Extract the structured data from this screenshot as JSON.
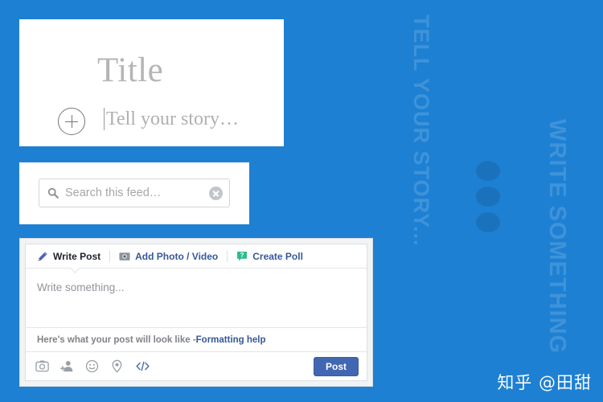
{
  "background": {
    "color": "#1e80d2",
    "ghost_text_color": "#3e93da",
    "dot_color": "#1a72bd",
    "ghost_left": "TELL YOUR STORY...",
    "ghost_right": "WRITE SOMETHING"
  },
  "title_card": {
    "heading_placeholder": "Title",
    "story_placeholder": "Tell your story…",
    "add_button_label": "+"
  },
  "search_card": {
    "placeholder": "Search this feed…",
    "value": "",
    "clear_label": "×"
  },
  "composer": {
    "tabs": [
      {
        "label": "Write Post",
        "icon": "pencil-icon",
        "active": true
      },
      {
        "label": "Add Photo / Video",
        "icon": "camera-icon",
        "active": false
      },
      {
        "label": "Create Poll",
        "icon": "poll-icon",
        "active": false
      }
    ],
    "body_placeholder": "Write something...",
    "preview_text": "Here's what your post will look like - ",
    "preview_link": "Formatting help",
    "footer_icons": [
      "photo-icon",
      "tag-person-icon",
      "emoji-icon",
      "location-icon",
      "code-icon"
    ],
    "post_button": "Post",
    "post_button_color": "#4267b2"
  },
  "watermark": {
    "text": "知乎 @田甜"
  }
}
